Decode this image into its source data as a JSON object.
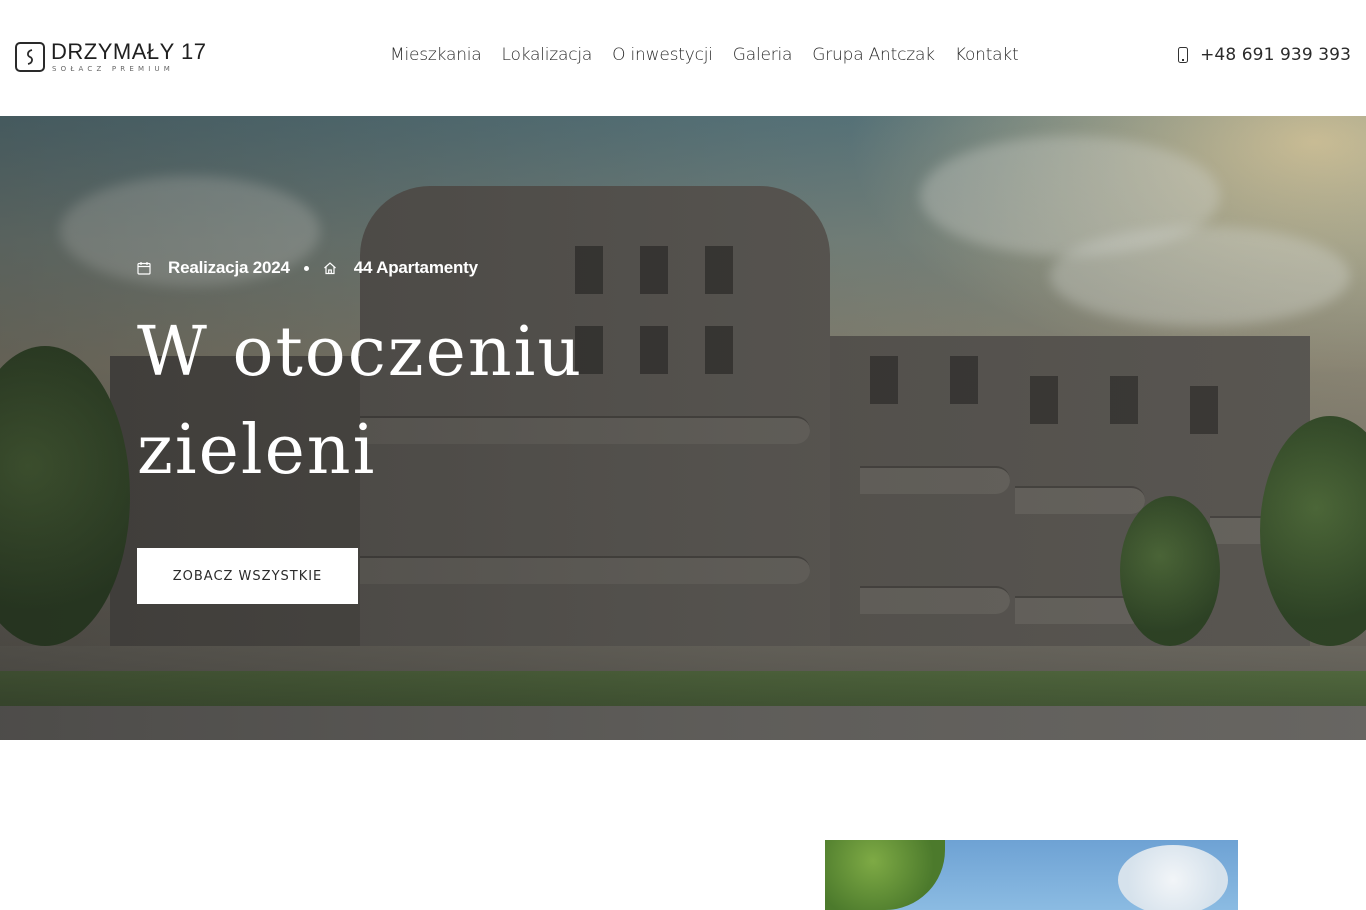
{
  "header": {
    "logo_title": "DRZYMAŁY 17",
    "logo_subtitle": "SOŁACZ PREMIUM",
    "nav": [
      "Mieszkania",
      "Lokalizacja",
      "O inwestycji",
      "Galeria",
      "Grupa Antczak",
      "Kontakt"
    ],
    "phone": "+48 691 939 393",
    "phone_icon": "phone-icon"
  },
  "hero": {
    "meta_realization": "Realizacja 2024",
    "meta_apartments": "44 Apartamenty",
    "headline": "W otoczeniu zieleni",
    "cta_label": "ZOBACZ WSZYSTKIE",
    "calendar_icon": "calendar-icon",
    "home_icon": "home-icon"
  },
  "colors": {
    "header_bg": "#ffffff",
    "text_dark": "#2b2b2b",
    "hero_text": "#ffffff",
    "cta_bg": "#ffffff"
  }
}
